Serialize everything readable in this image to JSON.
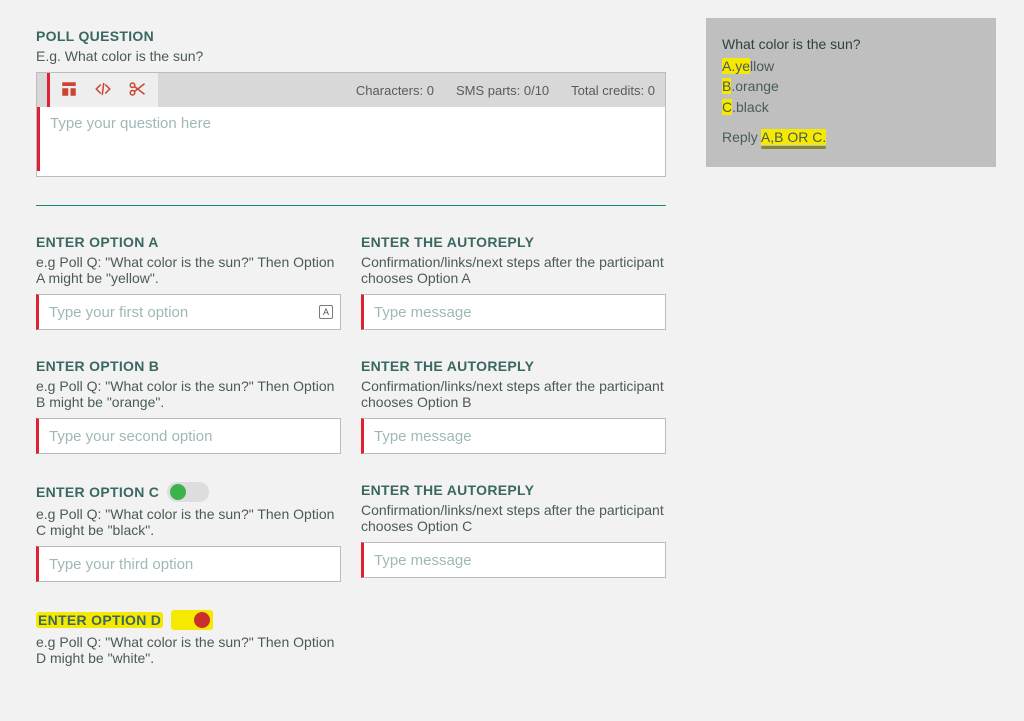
{
  "poll": {
    "label": "POLL QUESTION",
    "help": "E.g. What color is the sun?",
    "placeholder": "Type your question here",
    "stats": {
      "chars": "Characters: 0",
      "sms": "SMS parts: 0/10",
      "credits": "Total credits: 0"
    },
    "icons": [
      "template-icon",
      "code-icon",
      "scissors-icon"
    ]
  },
  "options": [
    {
      "label": "ENTER OPTION A",
      "help": "e.g Poll Q: \"What color is the sun?\" Then Option A might be \"yellow\".",
      "placeholder": "Type your first option",
      "reply_label": "ENTER THE AUTOREPLY",
      "reply_help": "Confirmation/links/next steps after the participant chooses Option A",
      "reply_placeholder": "Type message",
      "has_end_icon": true
    },
    {
      "label": "ENTER OPTION B",
      "help": "e.g Poll Q: \"What color is the sun?\" Then Option B might be \"orange\".",
      "placeholder": "Type your second option",
      "reply_label": "ENTER THE AUTOREPLY",
      "reply_help": "Confirmation/links/next steps after the participant chooses Option B",
      "reply_placeholder": "Type message"
    },
    {
      "label": "ENTER OPTION C",
      "help": "e.g Poll Q: \"What color is the sun?\" Then Option C might be \"black\".",
      "placeholder": "Type your third option",
      "reply_label": "ENTER THE AUTOREPLY",
      "reply_help": "Confirmation/links/next steps after the participant chooses Option C",
      "reply_placeholder": "Type message",
      "toggle": "on"
    },
    {
      "label": "ENTER OPTION D",
      "help": "e.g Poll Q: \"What color is the sun?\" Then Option D might be \"white\".",
      "toggle": "off",
      "highlight": true
    }
  ],
  "preview": {
    "question": "What color is the sun?",
    "optA_pre": "A.",
    "optA": "ye",
    "optA_rest": "llow",
    "optB": "B.orange",
    "optC": "C.black",
    "reply_pre": "Reply ",
    "reply_hl": "A,B OR C."
  }
}
